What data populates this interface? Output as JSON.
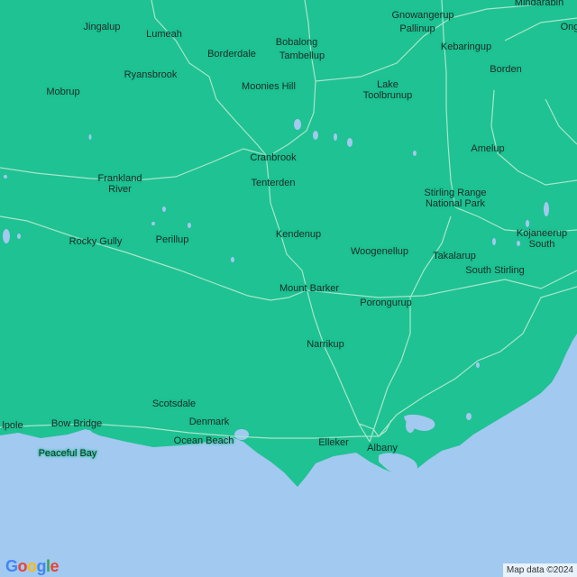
{
  "map": {
    "land_color": "#1fc293",
    "water_color": "#a2c9f0",
    "road_color": "#a8e6cc",
    "places": {
      "mindarabin": "Mindarabin",
      "ongerup": "Ong",
      "jingalup": "Jingalup",
      "lumeah": "Lumeah",
      "gnowangerup": "Gnowangerup",
      "pallinup": "Pallinup",
      "bobalong": "Bobalong",
      "tambellup": "Tambellup",
      "borderdale": "Borderdale",
      "kebaringup": "Kebaringup",
      "borden": "Borden",
      "ryansbrook": "Ryansbrook",
      "mobrup": "Mobrup",
      "moonies_hill": "Moonies Hill",
      "lake_toolbrunup": "Lake\nToolbrunup",
      "amelup": "Amelup",
      "cranbrook": "Cranbrook",
      "frankland_river": "Frankland\nRiver",
      "tenterden": "Tenterden",
      "stirling_range": "Stirling Range\nNational Park",
      "kojaneerup_south": "Kojaneerup\nSouth",
      "kendenup": "Kendenup",
      "rocky_gully": "Rocky Gully",
      "perillup": "Perillup",
      "woogenellup": "Woogenellup",
      "takalarup": "Takalarup",
      "south_stirling": "South Stirling",
      "mount_barker": "Mount Barker",
      "porongurup": "Porongurup",
      "narrikup": "Narrikup",
      "scotsdale": "Scotsdale",
      "walpole": "lpole",
      "bow_bridge": "Bow Bridge",
      "denmark": "Denmark",
      "ocean_beach": "Ocean Beach",
      "elleker": "Elleker",
      "albany": "Albany",
      "peaceful_bay": "Peaceful Bay"
    }
  },
  "footer": {
    "logo": [
      "G",
      "o",
      "o",
      "g",
      "l",
      "e"
    ],
    "logo_colors": [
      "#4285f4",
      "#ea4335",
      "#fbbc05",
      "#4285f4",
      "#34a853",
      "#ea4335"
    ],
    "attribution": "Map data ©2024"
  }
}
